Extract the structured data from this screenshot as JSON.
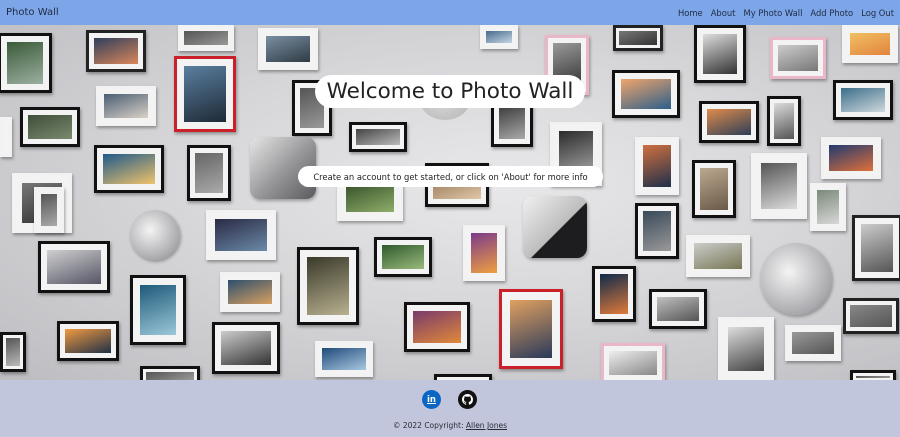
{
  "navbar": {
    "brand": "Photo Wall",
    "links": [
      "Home",
      "About",
      "My Photo Wall",
      "Add Photo",
      "Log Out"
    ]
  },
  "hero": {
    "title": "Welcome to Photo Wall",
    "subtitle": "Create an account to get started, or click on 'About' for more info"
  },
  "footer": {
    "social": [
      {
        "name": "linkedin-icon",
        "glyph": "in"
      },
      {
        "name": "github-icon",
        "glyph": ""
      }
    ],
    "copyright_prefix": "© 2022 Copyright:",
    "author": "Allen Jones"
  },
  "colors": {
    "navbar": "#7da6e8",
    "footer": "#c2c6dc",
    "linkedin": "#0a66c2",
    "github": "#111111"
  }
}
